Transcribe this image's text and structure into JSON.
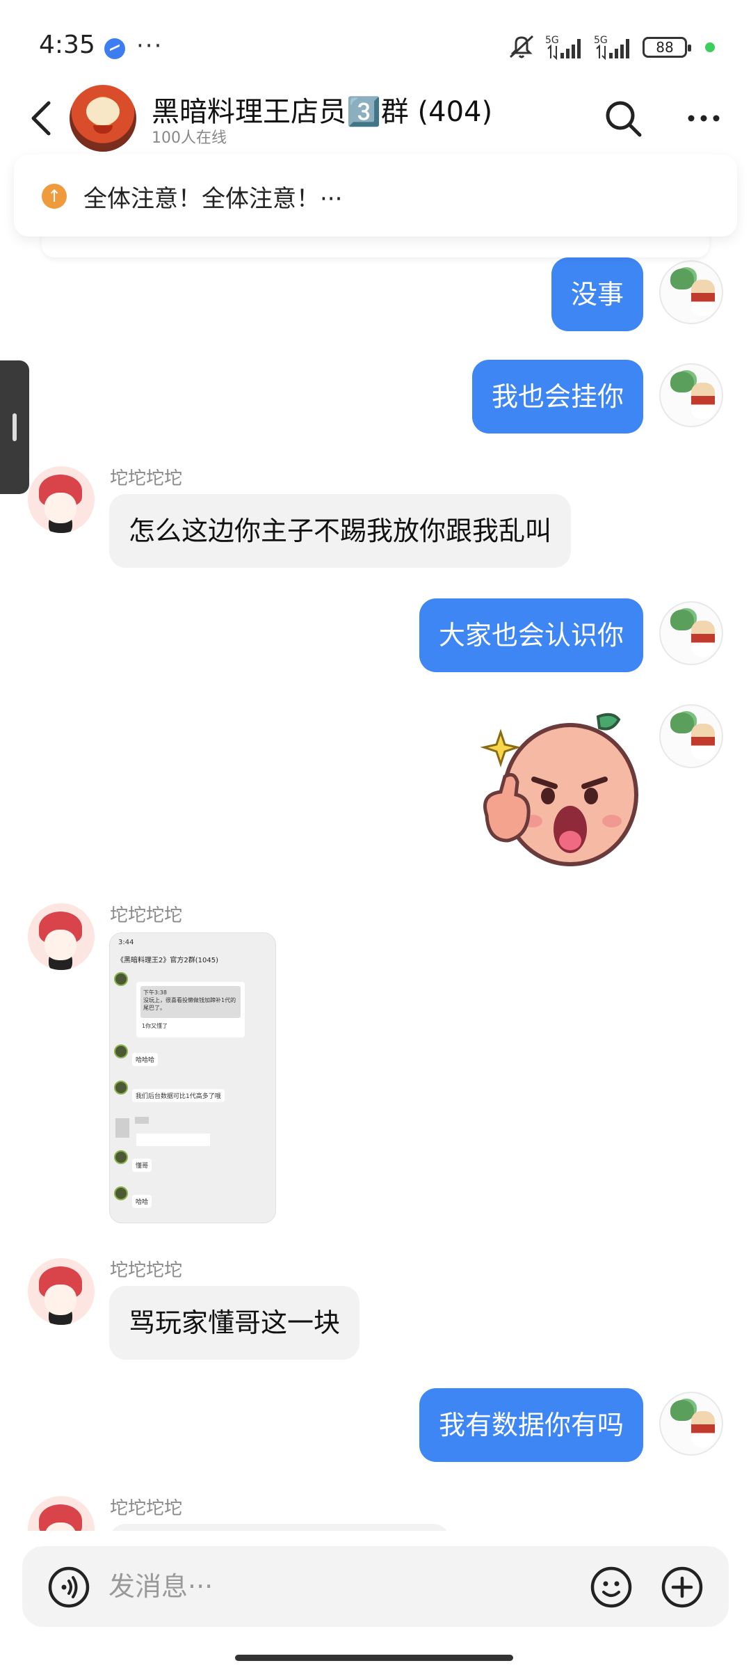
{
  "status_bar": {
    "time": "4:35",
    "dots": "···",
    "battery": "88",
    "net_label_1": "5G",
    "net_label_2": "5G"
  },
  "header": {
    "title": "黑暗料理王店员3️⃣群 (404)",
    "online": "100人在线",
    "back_icon": "chevron-left",
    "search_icon": "search",
    "more_icon": "more-horizontal"
  },
  "notice": {
    "text": "全体注意！全体注意！···",
    "icon": "arrow-up-circle"
  },
  "messages": [
    {
      "side": "out",
      "text": "没事"
    },
    {
      "side": "out",
      "text": "我也会挂你"
    },
    {
      "side": "in",
      "sender": "坨坨坨坨",
      "text": "怎么这边你主子不踢我放你跟我乱叫"
    },
    {
      "side": "out",
      "text": "大家也会认识你"
    },
    {
      "side": "out",
      "type": "sticker"
    },
    {
      "side": "in",
      "sender": "坨坨坨坨",
      "type": "image"
    },
    {
      "side": "in",
      "sender": "坨坨坨坨",
      "text": "骂玩家懂哥这一块"
    },
    {
      "side": "out",
      "text": "我有数据你有吗"
    },
    {
      "side": "in",
      "sender": "坨坨坨坨",
      "text": ""
    }
  ],
  "screenshot_thumb": {
    "status_time": "3:44",
    "title": "《黑暗料理王2》官方2群(1045)",
    "card_time": "下午3:38",
    "card_text": "没玩上，很喜看投懒做钱加蹄补1代的尾巴了。",
    "card_foot": "1你又懂了",
    "msg1": "哈哈哈",
    "msg2": "我们后台数据可比1代高多了哦",
    "msg3": "懂哥",
    "msg4": "哈哈"
  },
  "input": {
    "placeholder": "发消息···",
    "voice_icon": "voice",
    "emoji_icon": "smile",
    "plus_icon": "plus-circle"
  },
  "colors": {
    "outgoing_bubble": "#3f86f5",
    "incoming_bubble": "#f2f2f2",
    "notice_icon": "#f09a3e"
  }
}
